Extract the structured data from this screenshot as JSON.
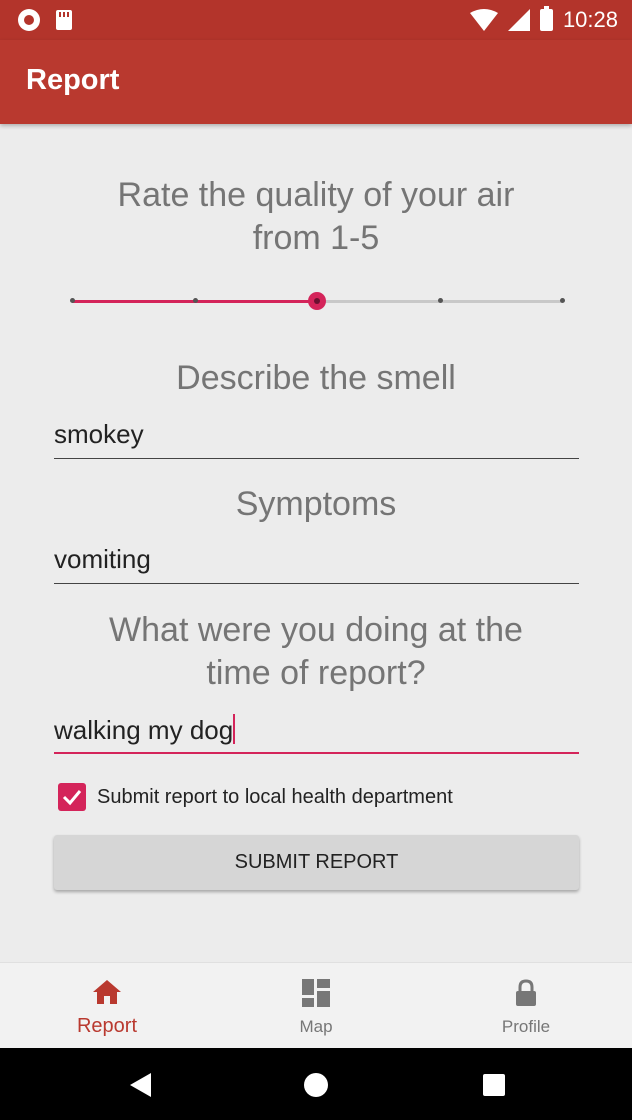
{
  "status_bar": {
    "time": "10:28",
    "icons": [
      "notification-dot-icon",
      "sd-card-icon",
      "wifi-icon",
      "signal-icon",
      "battery-icon"
    ]
  },
  "app_bar": {
    "title": "Report"
  },
  "form": {
    "rating_question": [
      "Rate the quality of your air",
      "from 1-5"
    ],
    "rating": {
      "min": 1,
      "max": 5,
      "value": 3
    },
    "smell_question": "Describe the smell",
    "smell_value": "smokey",
    "symptoms_question": "Symptoms",
    "symptoms_value": "vomiting",
    "activity_question": [
      "What were you doing at the",
      "time of report?"
    ],
    "activity_value": "walking my dog",
    "submit_checkbox": {
      "checked": true,
      "label": "Submit report to local health department"
    },
    "submit_button_label": "SUBMIT REPORT"
  },
  "bottom_nav": {
    "items": [
      {
        "label": "Report",
        "icon": "home-icon",
        "active": true
      },
      {
        "label": "Map",
        "icon": "dashboard-icon",
        "active": false
      },
      {
        "label": "Profile",
        "icon": "lock-icon",
        "active": false
      }
    ]
  },
  "system_nav": {
    "icons": [
      "back-icon",
      "home-circle-icon",
      "recents-icon"
    ]
  },
  "colors": {
    "primary": "#b9392f",
    "status_bar": "#b3342b",
    "accent": "#d4245a",
    "background": "#ececec"
  }
}
